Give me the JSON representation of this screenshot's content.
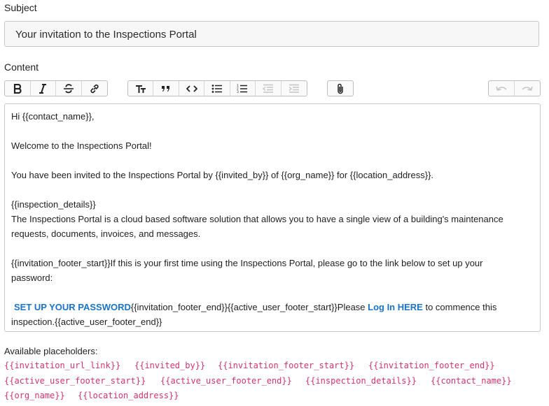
{
  "subject": {
    "label": "Subject",
    "value": "Your invitation to the Inspections Portal"
  },
  "content": {
    "label": "Content"
  },
  "toolbar": {
    "buttons": [
      "bold-icon",
      "italic-icon",
      "strikethrough-icon",
      "link-icon",
      "heading-icon",
      "quote-icon",
      "code-icon",
      "bullet-list-icon",
      "numbered-list-icon",
      "outdent-icon",
      "indent-icon",
      "attach-icon",
      "undo-icon",
      "redo-icon"
    ]
  },
  "editor": {
    "line1": "Hi {{contact_name}},",
    "line2": "Welcome to the Inspections Portal!",
    "line3": "You have been invited to the Inspections Portal by {{invited_by}} of {{org_name}} for {{location_address}}.",
    "line4": "{{inspection_details}}",
    "line5a": "The Inspections Portal is a cloud based software solution that allows you to have a single view of a building's maintenance",
    "line5b": "requests, documents, invoices, and messages.",
    "line6a": "{{invitation_footer_start}}If this is your first time using the Inspections Portal, please go to the link below to set up your",
    "line6b": "password:",
    "setup_link": "SET UP YOUR PASSWORD",
    "line7_mid": "{{invitation_footer_end}}{{active_user_footer_start}}Please ",
    "login_link": "Log In HERE",
    "line7_end": " to commence this",
    "line8": "inspection.{{active_user_footer_end}}"
  },
  "placeholders": {
    "label": "Available placeholders:",
    "items": [
      "{{invitation_url_link}}",
      "{{invited_by}}",
      "{{invitation_footer_start}}",
      "{{invitation_footer_end}}",
      "{{active_user_footer_start}}",
      "{{active_user_footer_end}}",
      "{{inspection_details}}",
      "{{contact_name}}",
      "{{org_name}}",
      "{{location_address}}"
    ]
  },
  "colors": {
    "placeholder": "#d6336c",
    "link": "#1a73c8"
  }
}
